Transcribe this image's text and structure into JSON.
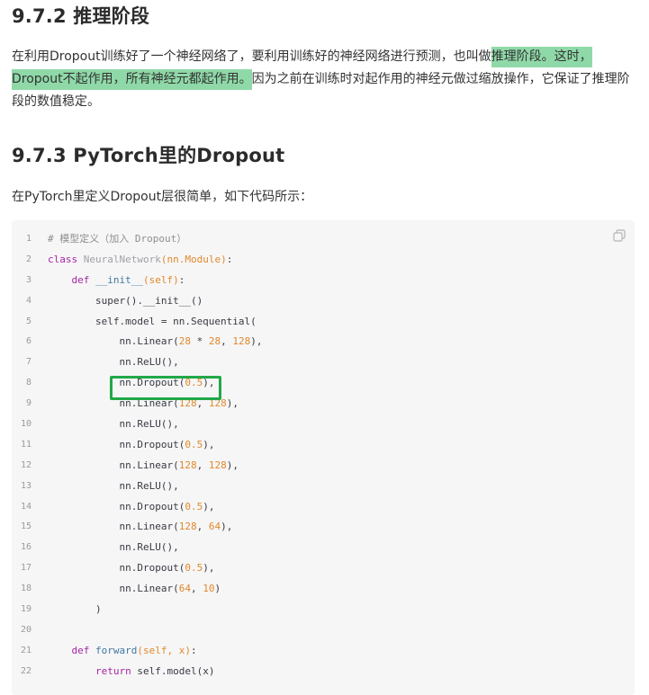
{
  "section_972": {
    "title": "9.7.2 推理阶段",
    "para_pre": "在利用Dropout训练好了一个神经网络了，要利用训练好的神经网络进行预测，也叫做",
    "para_highlight_1": "推理阶段。这时，",
    "para_highlight_2": "Dropout不起作用，所有神经元都起作用。",
    "para_post": "因为之前在训练时对起作用的神经元做过缩放操作，它保证了推理阶段的数值稳定。"
  },
  "section_973": {
    "title": "9.7.3 PyTorch里的Dropout",
    "intro": "在PyTorch里定义Dropout层很简单，如下代码所示："
  },
  "code": {
    "copy_icon": "copy-icon",
    "line_numbers": [
      "1",
      "2",
      "3",
      "4",
      "5",
      "6",
      "7",
      "8",
      "9",
      "10",
      "11",
      "12",
      "13",
      "14",
      "15",
      "16",
      "17",
      "18",
      "19",
      "20",
      "21",
      "22"
    ],
    "lines": [
      [
        {
          "t": "# 模型定义（加入 Dropout）",
          "c": "tok-comment"
        }
      ],
      [
        {
          "t": "class ",
          "c": "tok-kw"
        },
        {
          "t": "NeuralNetwork",
          "c": "tok-cls"
        },
        {
          "t": "(nn.Module)",
          "c": "tok-param"
        },
        {
          "t": ":",
          "c": ""
        }
      ],
      [
        {
          "t": "    def ",
          "c": "tok-kw"
        },
        {
          "t": "__init__",
          "c": "tok-fn"
        },
        {
          "t": "(self)",
          "c": "tok-param"
        },
        {
          "t": ":",
          "c": ""
        }
      ],
      [
        {
          "t": "        super().__init__()",
          "c": ""
        }
      ],
      [
        {
          "t": "        self.model = nn.Sequential(",
          "c": ""
        }
      ],
      [
        {
          "t": "            nn.Linear(",
          "c": ""
        },
        {
          "t": "28",
          "c": "tok-num"
        },
        {
          "t": " * ",
          "c": ""
        },
        {
          "t": "28",
          "c": "tok-num"
        },
        {
          "t": ", ",
          "c": ""
        },
        {
          "t": "128",
          "c": "tok-num"
        },
        {
          "t": "),",
          "c": ""
        }
      ],
      [
        {
          "t": "            nn.ReLU(),",
          "c": ""
        }
      ],
      [
        {
          "t": "            nn.Dropout(",
          "c": ""
        },
        {
          "t": "0.5",
          "c": "tok-num"
        },
        {
          "t": "),",
          "c": ""
        }
      ],
      [
        {
          "t": "            nn.Linear(",
          "c": ""
        },
        {
          "t": "128",
          "c": "tok-num"
        },
        {
          "t": ", ",
          "c": ""
        },
        {
          "t": "128",
          "c": "tok-num"
        },
        {
          "t": "),",
          "c": ""
        }
      ],
      [
        {
          "t": "            nn.ReLU(),",
          "c": ""
        }
      ],
      [
        {
          "t": "            nn.Dropout(",
          "c": ""
        },
        {
          "t": "0.5",
          "c": "tok-num"
        },
        {
          "t": "),",
          "c": ""
        }
      ],
      [
        {
          "t": "            nn.Linear(",
          "c": ""
        },
        {
          "t": "128",
          "c": "tok-num"
        },
        {
          "t": ", ",
          "c": ""
        },
        {
          "t": "128",
          "c": "tok-num"
        },
        {
          "t": "),",
          "c": ""
        }
      ],
      [
        {
          "t": "            nn.ReLU(),",
          "c": ""
        }
      ],
      [
        {
          "t": "            nn.Dropout(",
          "c": ""
        },
        {
          "t": "0.5",
          "c": "tok-num"
        },
        {
          "t": "),",
          "c": ""
        }
      ],
      [
        {
          "t": "            nn.Linear(",
          "c": ""
        },
        {
          "t": "128",
          "c": "tok-num"
        },
        {
          "t": ", ",
          "c": ""
        },
        {
          "t": "64",
          "c": "tok-num"
        },
        {
          "t": "),",
          "c": ""
        }
      ],
      [
        {
          "t": "            nn.ReLU(),",
          "c": ""
        }
      ],
      [
        {
          "t": "            nn.Dropout(",
          "c": ""
        },
        {
          "t": "0.5",
          "c": "tok-num"
        },
        {
          "t": "),",
          "c": ""
        }
      ],
      [
        {
          "t": "            nn.Linear(",
          "c": ""
        },
        {
          "t": "64",
          "c": "tok-num"
        },
        {
          "t": ", ",
          "c": ""
        },
        {
          "t": "10",
          "c": "tok-num"
        },
        {
          "t": ")",
          "c": ""
        }
      ],
      [
        {
          "t": "        )",
          "c": ""
        }
      ],
      [
        {
          "t": "",
          "c": ""
        }
      ],
      [
        {
          "t": "    def ",
          "c": "tok-kw"
        },
        {
          "t": "forward",
          "c": "tok-fn"
        },
        {
          "t": "(self, x)",
          "c": "tok-param"
        },
        {
          "t": ":",
          "c": ""
        }
      ],
      [
        {
          "t": "        return ",
          "c": "tok-kw"
        },
        {
          "t": "self.model(x)",
          "c": ""
        }
      ]
    ]
  },
  "colors": {
    "highlight_bg": "#8fd9a8",
    "box_border": "#22a848",
    "code_bg": "#f6f6f7"
  }
}
